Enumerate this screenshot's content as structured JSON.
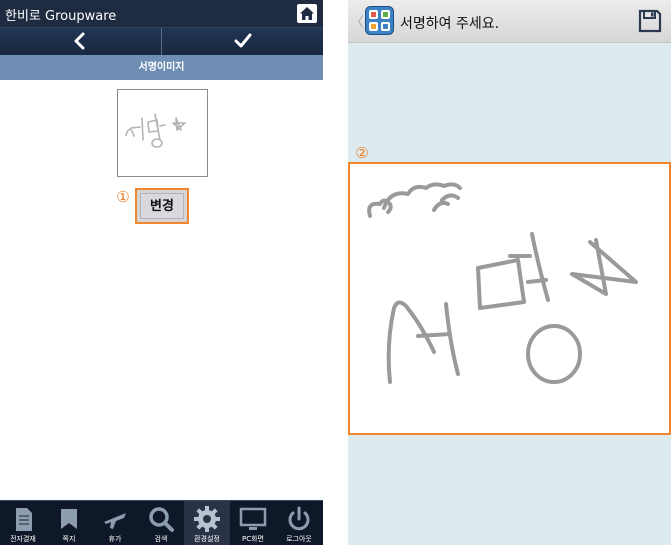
{
  "left": {
    "app_title": "한비로 Groupware",
    "section_title": "서명이미지",
    "step_marker": "①",
    "change_button": "변경",
    "tabs": [
      {
        "label": "전자결재",
        "icon": "document-icon"
      },
      {
        "label": "쪽지",
        "icon": "note-icon"
      },
      {
        "label": "휴가",
        "icon": "airplane-icon"
      },
      {
        "label": "검색",
        "icon": "search-icon"
      },
      {
        "label": "환경설정",
        "icon": "gear-icon",
        "active": true
      },
      {
        "label": "PC화면",
        "icon": "monitor-icon"
      },
      {
        "label": "로그아웃",
        "icon": "power-icon"
      }
    ]
  },
  "right": {
    "back_glyph": "〈",
    "title": "서명하여 주세요.",
    "step_marker": "②"
  },
  "colors": {
    "titlebar": "#1e2b40",
    "section_header": "#6f8eb4",
    "accent_orange": "#f0862e",
    "stroke_gray": "#9a9a9a",
    "right_bg": "#ddeaee"
  }
}
